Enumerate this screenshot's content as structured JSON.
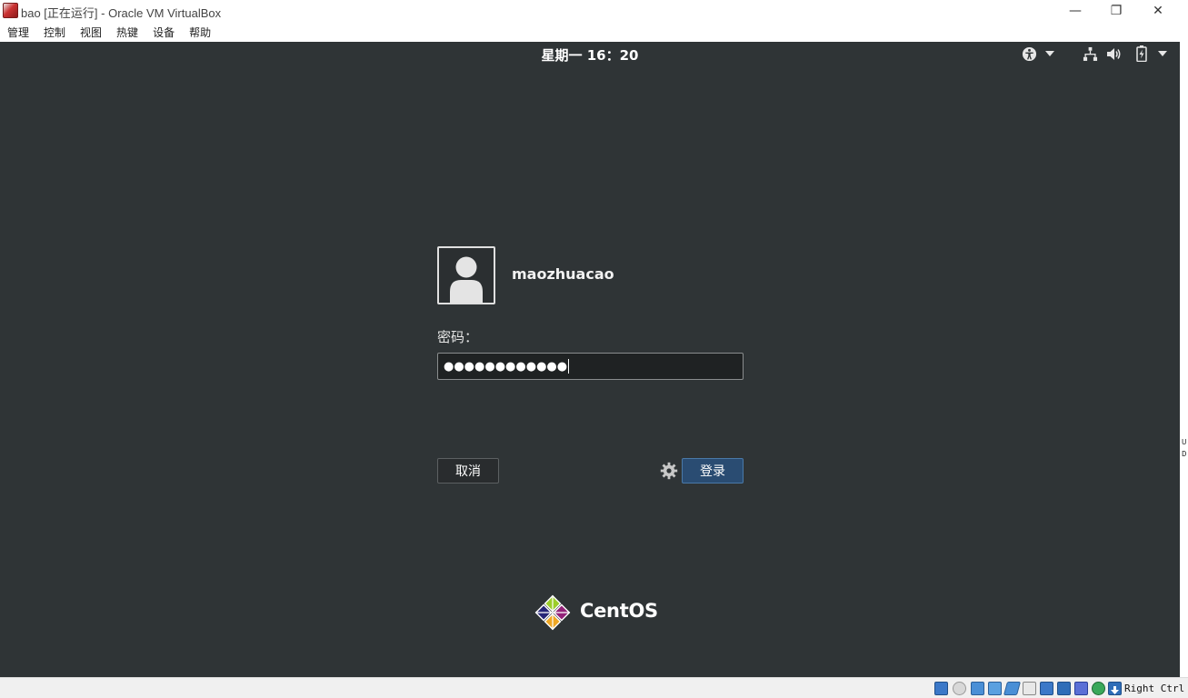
{
  "window": {
    "title": "bao [正在运行] - Oracle VM VirtualBox",
    "icon": "virtualbox-icon",
    "controls": {
      "minimize": "—",
      "restore": "❐",
      "close": "✕"
    }
  },
  "menubar": {
    "items": [
      {
        "label": "管理"
      },
      {
        "label": "控制"
      },
      {
        "label": "视图"
      },
      {
        "label": "热键"
      },
      {
        "label": "设备"
      },
      {
        "label": "帮助"
      }
    ]
  },
  "vm_screen": {
    "background_color": "#2f3436",
    "topbar": {
      "clock": "星期一 16：20",
      "tray_icons": [
        "accessibility-icon",
        "network-icon",
        "volume-icon",
        "battery-icon"
      ]
    },
    "login": {
      "username": "maozhuacao",
      "password_label": "密码：",
      "password_masked": "●●●●●●●●●●●●",
      "cancel_label": "取消",
      "login_label": "登录",
      "accent_color": "#2a4c72"
    },
    "brand": {
      "logo_text": "CentOS"
    },
    "edge_letters": [
      "U",
      "D"
    ]
  },
  "statusbar": {
    "host_key": "Right Ctrl",
    "icons": [
      "hard-disk-icon",
      "optical-drive-icon",
      "audio-icon",
      "network-adapter-icon",
      "usb-icon",
      "shared-folders-icon",
      "display-icon",
      "recording-icon",
      "cpu-icon",
      "mouse-integration-icon",
      "arrow-down-icon"
    ]
  }
}
